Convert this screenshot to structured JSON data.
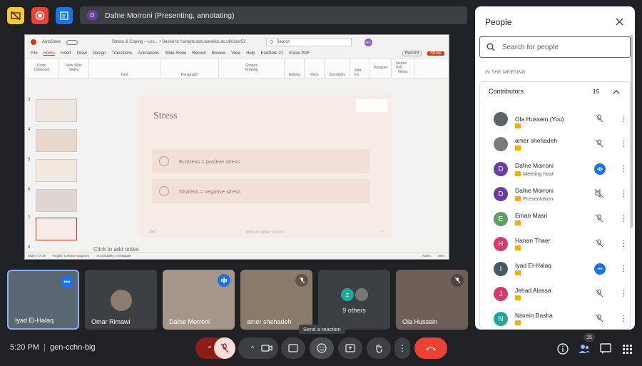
{
  "meeting": {
    "presenter_banner": "Dafne Morroni (Presenting, annotating)",
    "presenter_initial": "D"
  },
  "ppt": {
    "autosave": "AutoSave",
    "doc_title": "Stress & Coping – Lec... • Saved to \\\\simple.ads.warwick.ac.uk\\User52",
    "search_placeholder": "Search",
    "user_initials": "MO",
    "tabs": [
      "File",
      "Home",
      "Insert",
      "Draw",
      "Design",
      "Transitions",
      "Animations",
      "Slide Show",
      "Record",
      "Review",
      "View",
      "Help",
      "EndNote 21",
      "Kofax PDF"
    ],
    "record_btn": "Record",
    "share_btn": "Share",
    "ribbon_groups": [
      "Clipboard",
      "Slides",
      "Font",
      "Paragraph",
      "Drawing",
      "Editing",
      "Voice",
      "Sensitivity",
      "Add-ins",
      "Designer",
      "Viewa"
    ],
    "ribbon_buttons": [
      "Paste",
      "New Slide",
      "Reuse Slides",
      "Shapes",
      "Arrange",
      "Quick Styles",
      "Editing",
      "Dictate",
      "Sensitivity",
      "Add-ins",
      "Designer",
      "Inspire Poll"
    ],
    "thumb_numbers": [
      "3",
      "4",
      "5",
      "6",
      "7",
      "8"
    ],
    "slide_title": "Stress",
    "item1": "Eustress = positive stress",
    "item2": "Distress = negative stress",
    "footer_left": "2025",
    "footer_mid": "Stress & Coping - Lecture 2",
    "footer_right": "7",
    "notes_placeholder": "Click to add notes",
    "status_slide": "Slide 7 of 29",
    "status_lang": "English (United Kingdom)",
    "status_access": "Accessibility: Investigate",
    "status_notes": "Notes",
    "zoom": "56%"
  },
  "tiles": [
    {
      "name": "Iyad El-Halaq",
      "selected": true
    },
    {
      "name": "Omar Rimawi"
    },
    {
      "name": "Dafne Morroni"
    },
    {
      "name": "amer shehadeh"
    },
    {
      "name": "9 others",
      "avatar": "z"
    },
    {
      "name": "Ola Hussein"
    }
  ],
  "toolbar": {
    "time": "5:20 PM",
    "separator": "|",
    "meeting_code": "gen-cchn-big",
    "tooltip": "Send a reaction",
    "people_count": "15"
  },
  "people": {
    "title": "People",
    "search_placeholder": "Search for people",
    "section_label": "IN THE MEETING",
    "group_label": "Contributors",
    "group_count": "15",
    "list": [
      {
        "name": "Ola Hussein (You)",
        "role": "",
        "color": "#5f6368",
        "initial": ""
      },
      {
        "name": "amer shehadeh",
        "role": "",
        "color": "#7a7a7a",
        "initial": ""
      },
      {
        "name": "Dafne Morroni",
        "role": "Meeting host",
        "color": "#6a3ea1",
        "initial": "D"
      },
      {
        "name": "Dafne Morroni",
        "role": "Presentation",
        "color": "#6a3ea1",
        "initial": "D"
      },
      {
        "name": "Eman Masri",
        "role": "",
        "color": "#5f9d60",
        "initial": "E"
      },
      {
        "name": "Hanan Thaer",
        "role": "",
        "color": "#d93a6a",
        "initial": "H"
      },
      {
        "name": "Iyad El-Halaq",
        "role": "",
        "color": "#455a64",
        "initial": "I"
      },
      {
        "name": "Jehad Alassa",
        "role": "",
        "color": "#d93a6a",
        "initial": "J"
      },
      {
        "name": "Nisrein Basha",
        "role": "",
        "color": "#26a69a",
        "initial": "N"
      }
    ]
  },
  "colors": {
    "end_call": "#ea4335",
    "mic_off_bg": "#f9dedc",
    "accent_blue": "#1a73e8"
  }
}
